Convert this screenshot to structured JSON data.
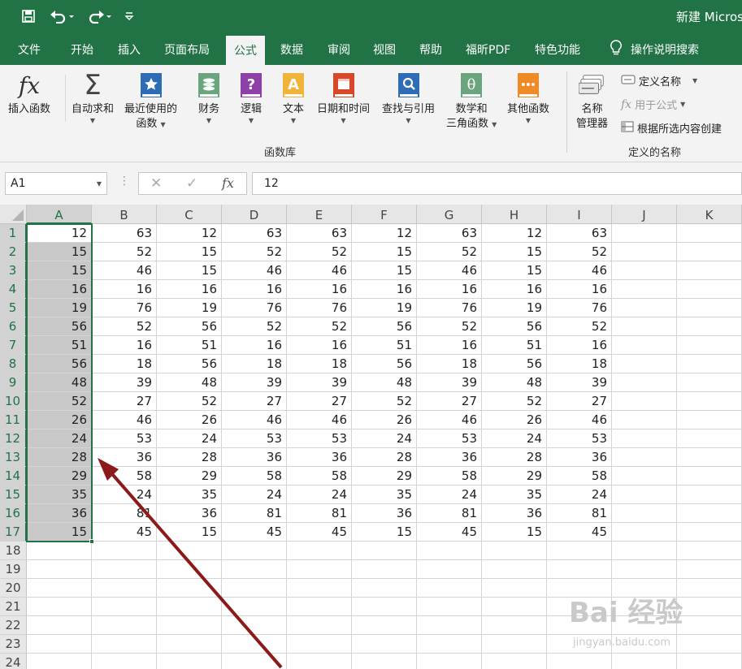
{
  "window": {
    "title": "新建 Micros"
  },
  "tabs": [
    "文件",
    "开始",
    "插入",
    "页面布局",
    "公式",
    "数据",
    "审阅",
    "视图",
    "帮助",
    "福昕PDF",
    "特色功能"
  ],
  "active_tab": "公式",
  "tell_me": "操作说明搜索",
  "ribbon": {
    "insert_function": "插入函数",
    "autosum": "自动求和",
    "recent_line1": "最近使用的",
    "recent_line2": "函数",
    "financial": "财务",
    "logical": "逻辑",
    "text": "文本",
    "datetime": "日期和时间",
    "lookup": "查找与引用",
    "math_line1": "数学和",
    "math_line2": "三角函数",
    "more": "其他函数",
    "library_label": "函数库",
    "name_manager_line1": "名称",
    "name_manager_line2": "管理器",
    "define_name": "定义名称",
    "use_in_formula": "用于公式",
    "create_from_selection": "根据所选内容创建",
    "defined_names_label": "定义的名称"
  },
  "formula_bar": {
    "name_box": "A1",
    "value": "12"
  },
  "columns": [
    "A",
    "B",
    "C",
    "D",
    "E",
    "F",
    "G",
    "H",
    "I",
    "J",
    "K"
  ],
  "rows": [
    "1",
    "2",
    "3",
    "4",
    "5",
    "6",
    "7",
    "8",
    "9",
    "10",
    "11",
    "12",
    "13",
    "14",
    "15",
    "16",
    "17",
    "18",
    "19",
    "20",
    "21",
    "22",
    "23",
    "24"
  ],
  "cells": [
    [
      "12",
      "63",
      "12",
      "63",
      "63",
      "12",
      "63",
      "12",
      "63",
      "",
      ""
    ],
    [
      "15",
      "52",
      "15",
      "52",
      "52",
      "15",
      "52",
      "15",
      "52",
      "",
      ""
    ],
    [
      "15",
      "46",
      "15",
      "46",
      "46",
      "15",
      "46",
      "15",
      "46",
      "",
      ""
    ],
    [
      "16",
      "16",
      "16",
      "16",
      "16",
      "16",
      "16",
      "16",
      "16",
      "",
      ""
    ],
    [
      "19",
      "76",
      "19",
      "76",
      "76",
      "19",
      "76",
      "19",
      "76",
      "",
      ""
    ],
    [
      "56",
      "52",
      "56",
      "52",
      "52",
      "56",
      "52",
      "56",
      "52",
      "",
      ""
    ],
    [
      "51",
      "16",
      "51",
      "16",
      "16",
      "51",
      "16",
      "51",
      "16",
      "",
      ""
    ],
    [
      "56",
      "18",
      "56",
      "18",
      "18",
      "56",
      "18",
      "56",
      "18",
      "",
      ""
    ],
    [
      "48",
      "39",
      "48",
      "39",
      "39",
      "48",
      "39",
      "48",
      "39",
      "",
      ""
    ],
    [
      "52",
      "27",
      "52",
      "27",
      "27",
      "52",
      "27",
      "52",
      "27",
      "",
      ""
    ],
    [
      "26",
      "46",
      "26",
      "46",
      "46",
      "26",
      "46",
      "26",
      "46",
      "",
      ""
    ],
    [
      "24",
      "53",
      "24",
      "53",
      "53",
      "24",
      "53",
      "24",
      "53",
      "",
      ""
    ],
    [
      "28",
      "36",
      "28",
      "36",
      "36",
      "28",
      "36",
      "28",
      "36",
      "",
      ""
    ],
    [
      "29",
      "58",
      "29",
      "58",
      "58",
      "29",
      "58",
      "29",
      "58",
      "",
      ""
    ],
    [
      "35",
      "24",
      "35",
      "24",
      "24",
      "35",
      "24",
      "35",
      "24",
      "",
      ""
    ],
    [
      "36",
      "81",
      "36",
      "81",
      "81",
      "36",
      "81",
      "36",
      "81",
      "",
      ""
    ],
    [
      "15",
      "45",
      "15",
      "45",
      "45",
      "15",
      "45",
      "15",
      "45",
      "",
      ""
    ],
    [
      "",
      "",
      "",
      "",
      "",
      "",
      "",
      "",
      "",
      "",
      ""
    ],
    [
      "",
      "",
      "",
      "",
      "",
      "",
      "",
      "",
      "",
      "",
      ""
    ],
    [
      "",
      "",
      "",
      "",
      "",
      "",
      "",
      "",
      "",
      "",
      ""
    ],
    [
      "",
      "",
      "",
      "",
      "",
      "",
      "",
      "",
      "",
      "",
      ""
    ],
    [
      "",
      "",
      "",
      "",
      "",
      "",
      "",
      "",
      "",
      "",
      ""
    ],
    [
      "",
      "",
      "",
      "",
      "",
      "",
      "",
      "",
      "",
      "",
      ""
    ],
    [
      "",
      "",
      "",
      "",
      "",
      "",
      "",
      "",
      "",
      "",
      ""
    ]
  ],
  "selection": "A1:A17",
  "watermark": {
    "text": "Bai 经验",
    "url": "jingyan.baidu.com"
  },
  "colors": {
    "excel_green": "#217346",
    "selection_fill": "#c8c8c8",
    "arrow": "#8b1a1a"
  }
}
